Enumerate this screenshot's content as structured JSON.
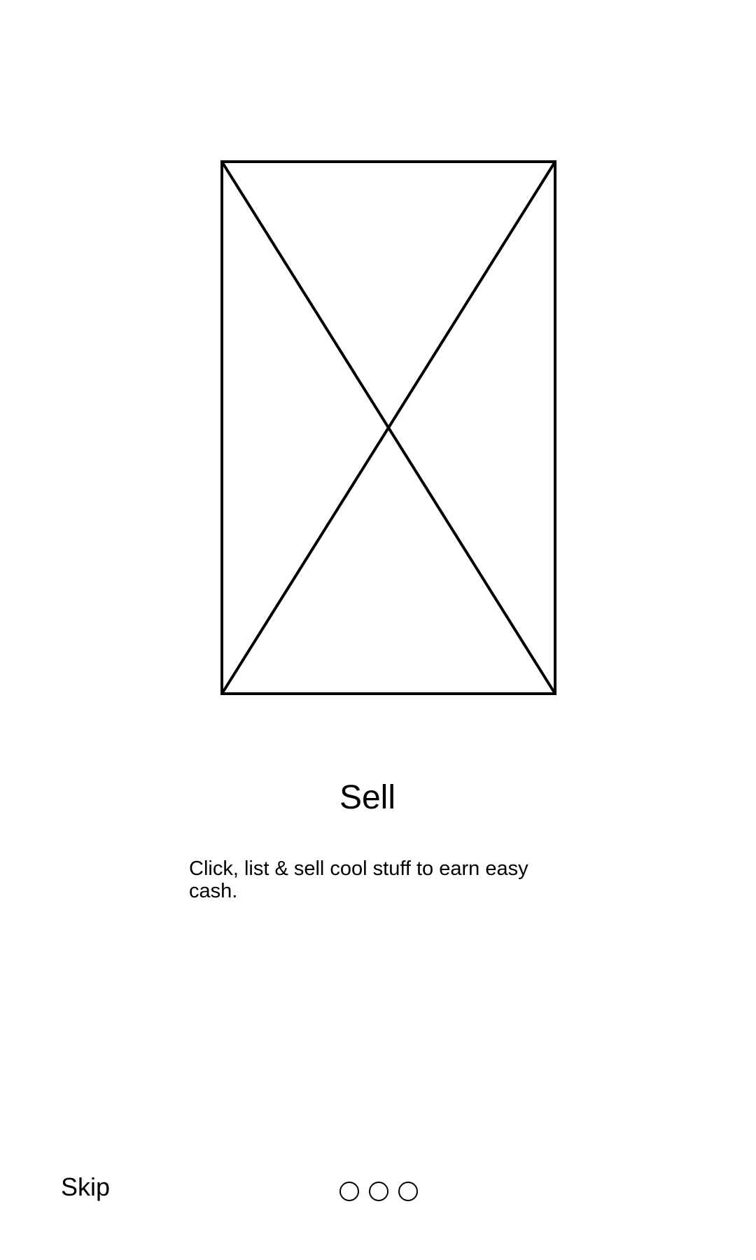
{
  "onboarding": {
    "image": {
      "icon": "image-placeholder-icon"
    },
    "title": "Sell",
    "description": "Click, list & sell cool stuff to earn easy cash.",
    "skip_label": "Skip",
    "page_indicator": {
      "total_pages": 3,
      "current_page": null
    }
  }
}
